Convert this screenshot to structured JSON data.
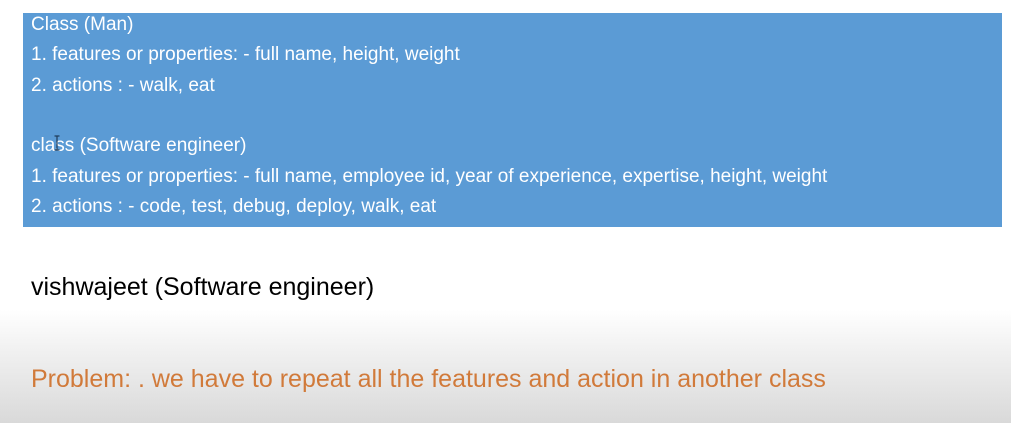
{
  "slide": {
    "box": {
      "background": "#5b9bd5",
      "text_color": "#ffffff",
      "lines": [
        "Class (Man)",
        "1. features or properties: - full name, height, weight",
        "2. actions : - walk, eat",
        "class (Software engineer)",
        "1. features or properties: - full name, employee id, year of experience, expertise, height, weight",
        "2. actions : - code, test, debug, deploy, walk, eat"
      ]
    },
    "example_text": "vishwajeet (Software engineer)",
    "problem_text": "Problem: . we have to repeat all the features and action in another class",
    "problem_color": "#d17a3a",
    "cursor_icon": "text-cursor-icon"
  }
}
